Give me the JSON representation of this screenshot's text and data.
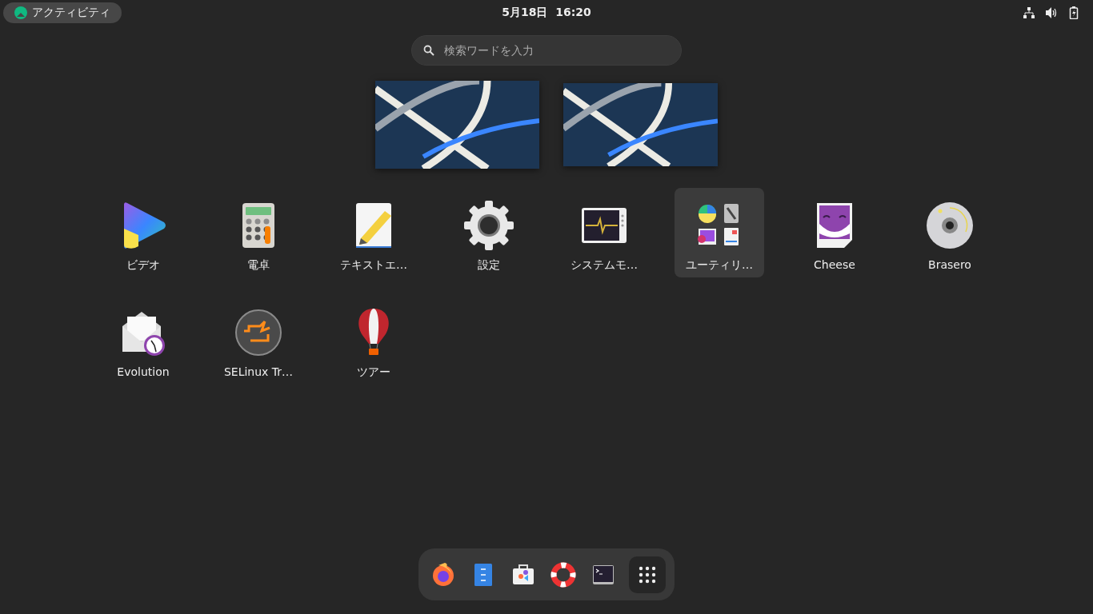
{
  "top_bar": {
    "activities": "アクティビティ",
    "clock": "5月18日  16:20"
  },
  "search": {
    "placeholder": "検索ワードを入力"
  },
  "workspaces": [
    {
      "selected": true
    },
    {
      "selected": false
    }
  ],
  "apps": [
    {
      "kind": "app",
      "label": "ビデオ",
      "selected": false
    },
    {
      "kind": "app",
      "label": "電卓",
      "selected": false
    },
    {
      "kind": "app",
      "label": "テキストエ…",
      "selected": false
    },
    {
      "kind": "app",
      "label": "設定",
      "selected": false
    },
    {
      "kind": "app",
      "label": "システムモ…",
      "selected": false
    },
    {
      "kind": "folder",
      "label": "ユーティリ…",
      "selected": true
    },
    {
      "kind": "app",
      "label": "Cheese",
      "selected": false
    },
    {
      "kind": "app",
      "label": "Brasero",
      "selected": false
    },
    {
      "kind": "app",
      "label": "Evolution",
      "selected": false
    },
    {
      "kind": "app",
      "label": "SELinux Tr…",
      "selected": false
    },
    {
      "kind": "app",
      "label": "ツアー",
      "selected": false
    }
  ],
  "dock": {
    "show_apps_active": true
  }
}
